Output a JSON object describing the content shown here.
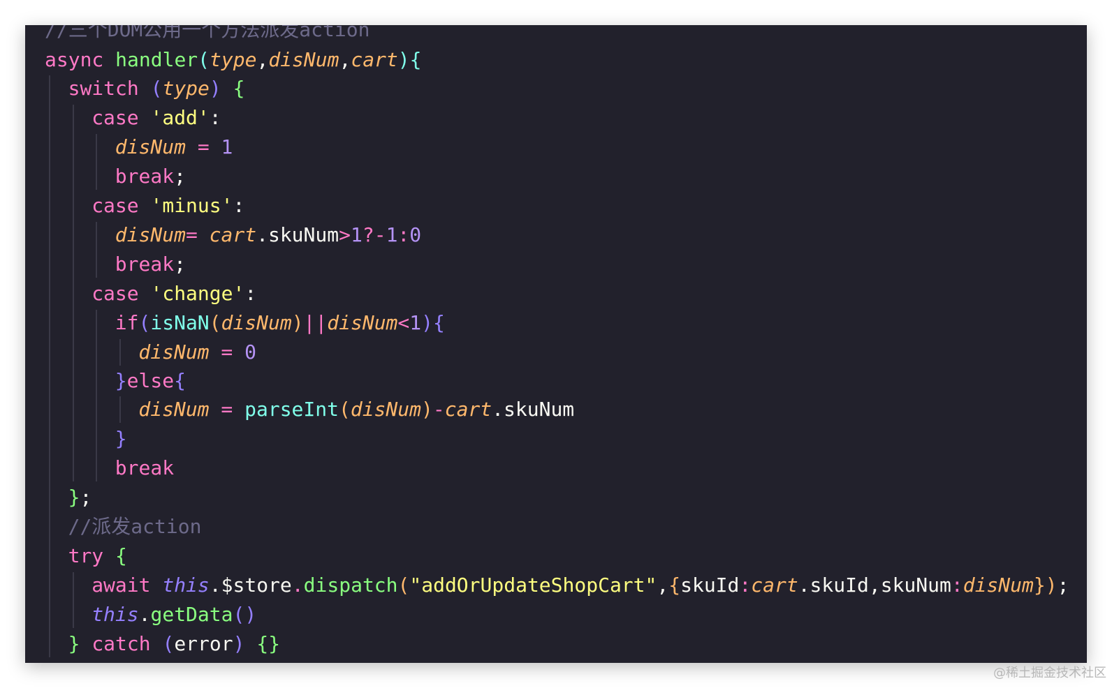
{
  "colors": {
    "background": "#22212c",
    "comment": "#6d6a8a",
    "keyword": "#ff79c6",
    "function": "#8aff80",
    "param": "#ffb86c",
    "string": "#ffff80",
    "number": "#b593f5",
    "builtin": "#80ffea",
    "purple": "#9580ff",
    "plain": "#f8f8f2"
  },
  "watermark": "@稀土掘金技术社区",
  "lines": [
    [
      [
        "c",
        "//三个DOM公用一个方法派发action"
      ]
    ],
    [
      [
        "k",
        "async "
      ],
      [
        "f",
        "handler"
      ],
      [
        "b",
        "("
      ],
      [
        "pi",
        "type"
      ],
      [
        "p",
        ","
      ],
      [
        "pi",
        "disNum"
      ],
      [
        "p",
        ","
      ],
      [
        "pi",
        "cart"
      ],
      [
        "b",
        "){"
      ]
    ],
    [
      [
        "k",
        "switch "
      ],
      [
        "v",
        "("
      ],
      [
        "pi",
        "type"
      ],
      [
        "v",
        ") "
      ],
      [
        "f",
        "{"
      ]
    ],
    [
      [
        "k",
        "case "
      ],
      [
        "s",
        "'add'"
      ],
      [
        "p",
        ":"
      ]
    ],
    [
      [
        "pi",
        "disNum "
      ],
      [
        "k",
        "= "
      ],
      [
        "n",
        "1"
      ]
    ],
    [
      [
        "k",
        "break"
      ],
      [
        "p",
        ";"
      ]
    ],
    [
      [
        "k",
        "case "
      ],
      [
        "s",
        "'minus'"
      ],
      [
        "p",
        ":"
      ]
    ],
    [
      [
        "pi",
        "disNum"
      ],
      [
        "k",
        "= "
      ],
      [
        "pi",
        "cart"
      ],
      [
        "p",
        ".skuNum"
      ],
      [
        "k",
        ">"
      ],
      [
        "n",
        "1"
      ],
      [
        "k",
        "?-"
      ],
      [
        "n",
        "1"
      ],
      [
        "k",
        ":"
      ],
      [
        "n",
        "0"
      ]
    ],
    [
      [
        "k",
        "break"
      ],
      [
        "p",
        ";"
      ]
    ],
    [
      [
        "k",
        "case "
      ],
      [
        "s",
        "'change'"
      ],
      [
        "p",
        ":"
      ]
    ],
    [
      [
        "k",
        "if"
      ],
      [
        "v",
        "("
      ],
      [
        "bu",
        "isNaN"
      ],
      [
        "pa",
        "("
      ],
      [
        "pi",
        "disNum"
      ],
      [
        "pa",
        ")"
      ],
      [
        "k",
        "||"
      ],
      [
        "pi",
        "disNum"
      ],
      [
        "k",
        "<"
      ],
      [
        "n",
        "1"
      ],
      [
        "v",
        "){"
      ]
    ],
    [
      [
        "pi",
        "disNum "
      ],
      [
        "k",
        "= "
      ],
      [
        "n",
        "0"
      ]
    ],
    [
      [
        "v",
        "}"
      ],
      [
        "k",
        "else"
      ],
      [
        "v",
        "{"
      ]
    ],
    [
      [
        "pi",
        "disNum "
      ],
      [
        "k",
        "= "
      ],
      [
        "bu",
        "parseInt"
      ],
      [
        "pa",
        "("
      ],
      [
        "pi",
        "disNum"
      ],
      [
        "pa",
        ")"
      ],
      [
        "k",
        "-"
      ],
      [
        "pi",
        "cart"
      ],
      [
        "p",
        ".skuNum"
      ]
    ],
    [
      [
        "v",
        "}"
      ]
    ],
    [
      [
        "k",
        "break"
      ]
    ],
    [
      [
        "f",
        "}"
      ],
      [
        "p",
        ";"
      ]
    ],
    [
      [
        "c",
        "//派发action"
      ]
    ],
    [
      [
        "k",
        "try "
      ],
      [
        "f",
        "{"
      ]
    ],
    [
      [
        "k",
        "await "
      ],
      [
        "vi",
        "this"
      ],
      [
        "p",
        ".$store"
      ],
      [
        "k",
        "."
      ],
      [
        "f",
        "dispatch"
      ],
      [
        "pa",
        "("
      ],
      [
        "s",
        "\"addOrUpdateShopCart\""
      ],
      [
        "p",
        ","
      ],
      [
        "pa",
        "{"
      ],
      [
        "p",
        "skuId"
      ],
      [
        "k",
        ":"
      ],
      [
        "pi",
        "cart"
      ],
      [
        "p",
        ".skuId,skuNum"
      ],
      [
        "k",
        ":"
      ],
      [
        "pi",
        "disNum"
      ],
      [
        "pa",
        "}"
      ],
      [
        "pa",
        ")"
      ],
      [
        "p",
        ";"
      ]
    ],
    [
      [
        "vi",
        "this"
      ],
      [
        "p",
        "."
      ],
      [
        "f",
        "getData"
      ],
      [
        "v",
        "()"
      ]
    ],
    [
      [
        "f",
        "} "
      ],
      [
        "k",
        "catch "
      ],
      [
        "v",
        "("
      ],
      [
        "p",
        "error"
      ],
      [
        "v",
        ") "
      ],
      [
        "f",
        "{}"
      ]
    ]
  ]
}
